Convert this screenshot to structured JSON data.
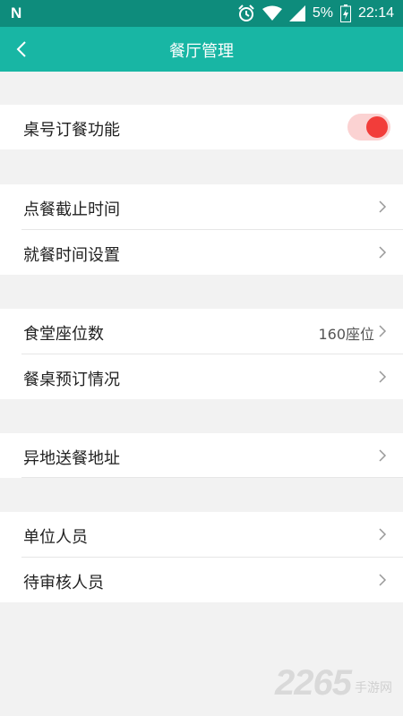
{
  "status_bar": {
    "logo": "N",
    "battery": "5%",
    "time": "22:14"
  },
  "app_bar": {
    "title": "餐厅管理"
  },
  "groups": [
    {
      "items": [
        {
          "label": "桌号订餐功能",
          "toggle_on": true
        }
      ]
    },
    {
      "items": [
        {
          "label": "点餐截止时间"
        },
        {
          "label": "就餐时间设置"
        }
      ]
    },
    {
      "items": [
        {
          "label": "食堂座位数",
          "value": "160座位"
        },
        {
          "label": "餐桌预订情况"
        }
      ]
    },
    {
      "items": [
        {
          "label": "异地送餐地址"
        }
      ]
    },
    {
      "items": [
        {
          "label": "单位人员"
        },
        {
          "label": "待审核人员"
        }
      ]
    }
  ],
  "watermark": {
    "number": "2265",
    "site": "手游网"
  },
  "colors": {
    "status_bar": "#0e8c7c",
    "app_bar": "#18b6a4",
    "toggle_knob": "#f23d3a",
    "toggle_track": "#fbd2d2"
  }
}
